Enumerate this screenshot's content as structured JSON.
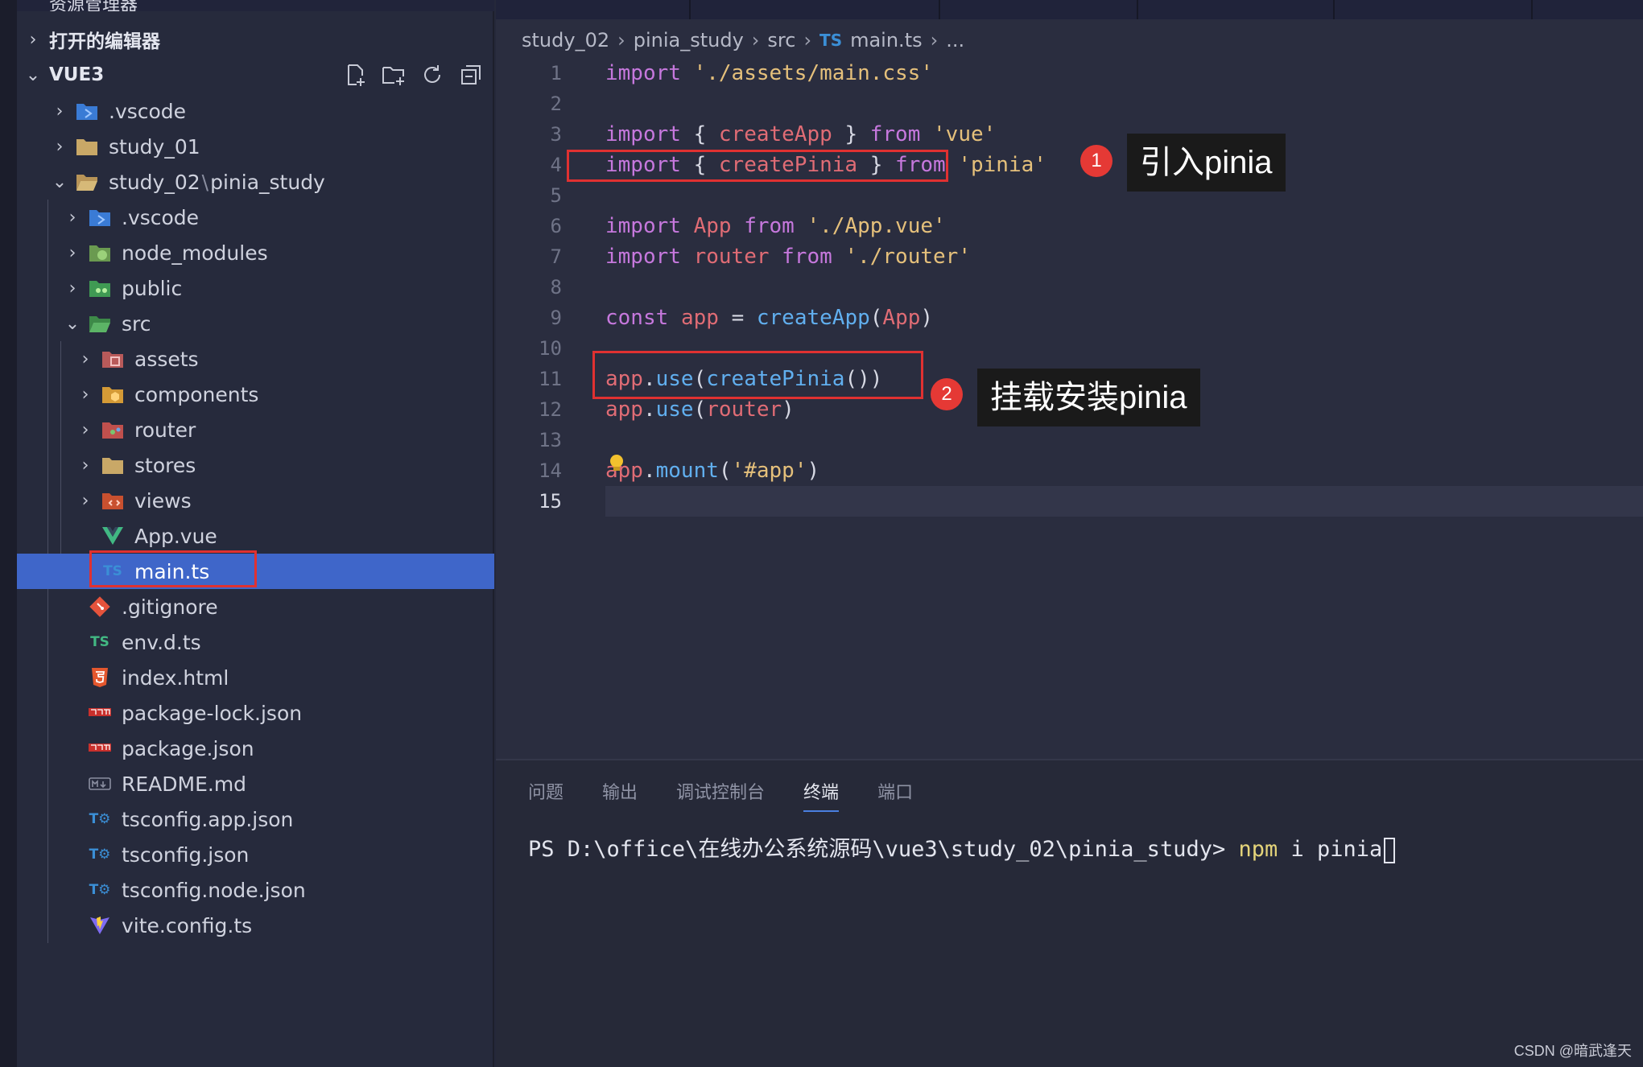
{
  "sidebar": {
    "header_partial": "资源管理器",
    "open_editors": "打开的编辑器",
    "workspace": "VUE3",
    "items": [
      {
        "label": ".vscode",
        "icon": "vscode-folder-icon"
      },
      {
        "label": "study_01",
        "icon": "folder-icon"
      },
      {
        "label": "study_02",
        "label_suffix": "pinia_study",
        "icon": "folder-open-icon"
      },
      {
        "label": ".vscode",
        "icon": "vscode-folder-icon"
      },
      {
        "label": "node_modules",
        "icon": "node-folder-icon"
      },
      {
        "label": "public",
        "icon": "public-folder-icon"
      },
      {
        "label": "src",
        "icon": "src-folder-icon"
      },
      {
        "label": "assets",
        "icon": "assets-folder-icon"
      },
      {
        "label": "components",
        "icon": "components-folder-icon"
      },
      {
        "label": "router",
        "icon": "router-folder-icon"
      },
      {
        "label": "stores",
        "icon": "folder-icon"
      },
      {
        "label": "views",
        "icon": "views-folder-icon"
      },
      {
        "label": "App.vue",
        "icon": "vue-file-icon"
      },
      {
        "label": "main.ts",
        "icon": "ts-file-icon"
      },
      {
        "label": ".gitignore",
        "icon": "git-icon"
      },
      {
        "label": "env.d.ts",
        "icon": "ts-file-icon"
      },
      {
        "label": "index.html",
        "icon": "html5-icon"
      },
      {
        "label": "package-lock.json",
        "icon": "npm-icon"
      },
      {
        "label": "package.json",
        "icon": "npm-icon"
      },
      {
        "label": "README.md",
        "icon": "markdown-icon"
      },
      {
        "label": "tsconfig.app.json",
        "icon": "tsconfig-icon"
      },
      {
        "label": "tsconfig.json",
        "icon": "tsconfig-icon"
      },
      {
        "label": "tsconfig.node.json",
        "icon": "tsconfig-icon"
      },
      {
        "label": "vite.config.ts",
        "icon": "vite-icon"
      }
    ]
  },
  "breadcrumb": {
    "parts": [
      "study_02",
      "pinia_study",
      "src"
    ],
    "file_badge": "TS",
    "file": "main.ts",
    "ellipsis": "..."
  },
  "editor": {
    "line_numbers": [
      "1",
      "2",
      "3",
      "4",
      "5",
      "6",
      "7",
      "8",
      "9",
      "10",
      "11",
      "12",
      "13",
      "14",
      "15"
    ],
    "lines": [
      "import './assets/main.css'",
      "",
      "import { createApp } from 'vue'",
      "import { createPinia } from 'pinia'",
      "",
      "import App from './App.vue'",
      "import router from './router'",
      "",
      "const app = createApp(App)",
      "",
      "app.use(createPinia())",
      "app.use(router)",
      "",
      "app.mount('#app')",
      ""
    ]
  },
  "annotations": [
    {
      "badge": "1",
      "text": "引入pinia"
    },
    {
      "badge": "2",
      "text": "挂载安装pinia"
    }
  ],
  "panel": {
    "tabs": [
      "问题",
      "输出",
      "调试控制台",
      "终端",
      "端口"
    ],
    "active_tab": "终端",
    "prompt": "PS D:\\office\\在线办公系统源码\\vue3\\study_02\\pinia_study>",
    "command": "npm",
    "args": " i pinia"
  },
  "watermark": "CSDN @暗武逢天",
  "colors": {
    "keyword": "#c678dd",
    "string": "#e5c07b",
    "identifier": "#e06c75",
    "function": "#61afef",
    "selection": "#3f66c9",
    "highlight_box": "#e03131"
  }
}
